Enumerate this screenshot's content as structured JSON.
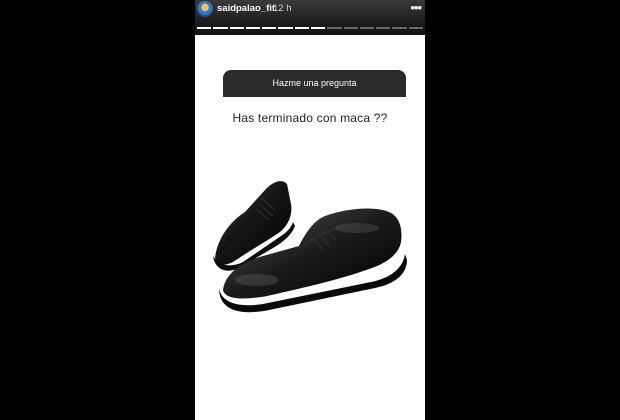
{
  "story": {
    "username": "saidpalao_fit",
    "time": "12 h",
    "more_icon": "more-dots-icon",
    "progress_total": 14,
    "progress_done": 8
  },
  "question_sticker": {
    "header": "Hazme una pregunta",
    "question": "Has terminado con maca ??"
  },
  "colors": {
    "sticker_header_bg": "#2b2b2b",
    "story_bg": "#ffffff"
  }
}
